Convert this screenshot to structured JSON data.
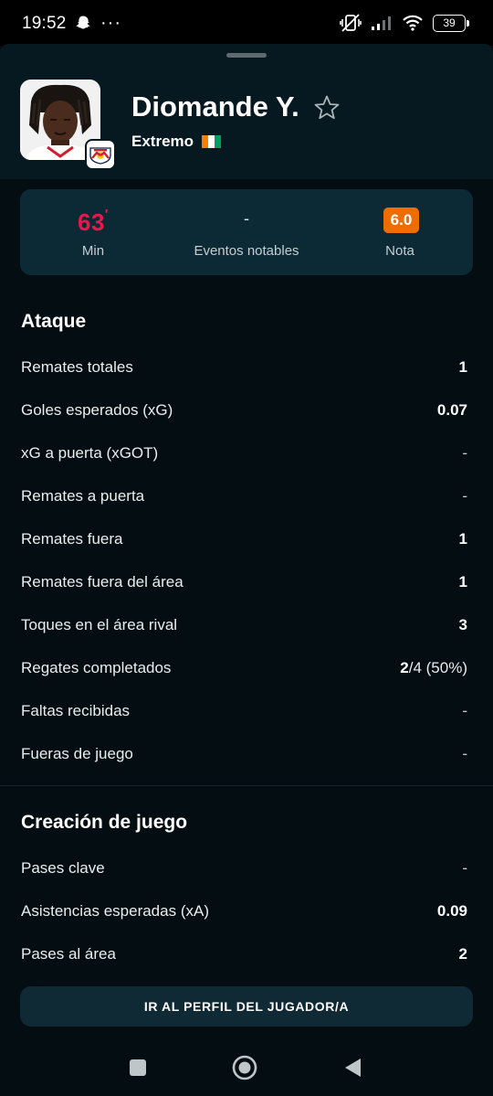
{
  "status_bar": {
    "time": "19:52",
    "more": "···",
    "battery": "39"
  },
  "player": {
    "name": "Diomande Y.",
    "position": "Extremo",
    "flag_colors": [
      "#f77f00",
      "#ffffff",
      "#009e60"
    ]
  },
  "summary": {
    "minutes_value": "63",
    "minutes_mark": "'",
    "minutes_label": "Min",
    "events_value": "-",
    "events_label": "Eventos notables",
    "rating_value": "6.0",
    "rating_label": "Nota",
    "rating_color": "#ef6c00"
  },
  "attack": {
    "title": "Ataque",
    "rows": [
      {
        "label": "Remates totales",
        "value": "1"
      },
      {
        "label": "Goles esperados (xG)",
        "value": "0.07"
      },
      {
        "label": "xG a puerta (xGOT)",
        "value": "-"
      },
      {
        "label": "Remates a puerta",
        "value": "-"
      },
      {
        "label": "Remates fuera",
        "value": "1"
      },
      {
        "label": "Remates fuera del área",
        "value": "1"
      },
      {
        "label": "Toques en el área rival",
        "value": "3"
      },
      {
        "label": "Regates completados",
        "value_bold": "2",
        "value_rest": "/4 (50%)"
      },
      {
        "label": "Faltas recibidas",
        "value": "-"
      },
      {
        "label": "Fueras de juego",
        "value": "-"
      }
    ]
  },
  "creation": {
    "title": "Creación de juego",
    "rows": [
      {
        "label": "Pases clave",
        "value": "-"
      },
      {
        "label": "Asistencias esperadas (xA)",
        "value": "0.09"
      },
      {
        "label": "Pases al área",
        "value": "2"
      }
    ]
  },
  "profile_button": "IR AL PERFIL DEL JUGADOR/A",
  "icons": {
    "snapchat": "snapchat-icon",
    "star": "star-outline-icon",
    "team": "team-crest-icon",
    "nav_recents": "square-icon",
    "nav_home": "circle-icon",
    "nav_back": "triangle-back-icon"
  },
  "colors": {
    "accent_red": "#e8184a",
    "rating_orange": "#ef6c00",
    "card_bg": "#0c2a36"
  }
}
